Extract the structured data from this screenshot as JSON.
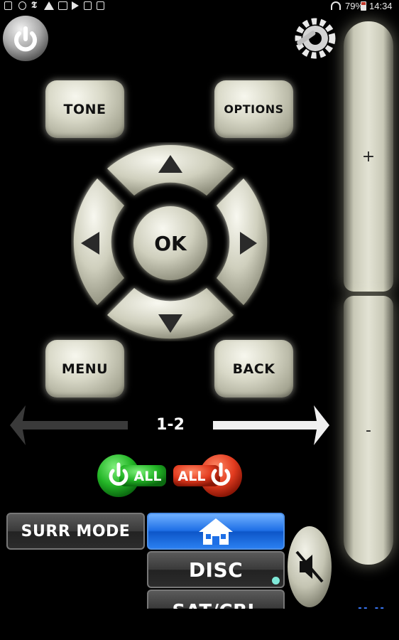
{
  "status_bar": {
    "battery": "79%",
    "time": "14:34"
  },
  "remote": {
    "tone_label": "TONE",
    "options_label": "OPTIONS",
    "ok_label": "OK",
    "menu_label": "MENU",
    "back_label": "BACK",
    "zone_label": "1-2",
    "volume_up_label": "+",
    "volume_down_label": "-",
    "all_on_label": "ALL",
    "all_off_label": "ALL",
    "surr_mode_label": "SURR MODE",
    "disc_label": "DISC",
    "sat_cbl_label": "SAT/CBL",
    "bottom_indicator": "-- --"
  },
  "colors": {
    "background": "#000000",
    "beige": "#d8d8c7",
    "accent_blue": "#1e6fe6",
    "active_dot": "#7fe8d8",
    "power_on_green": "#23b526",
    "power_off_red": "#e23b1f",
    "indicator_blue": "#3b7bff"
  }
}
